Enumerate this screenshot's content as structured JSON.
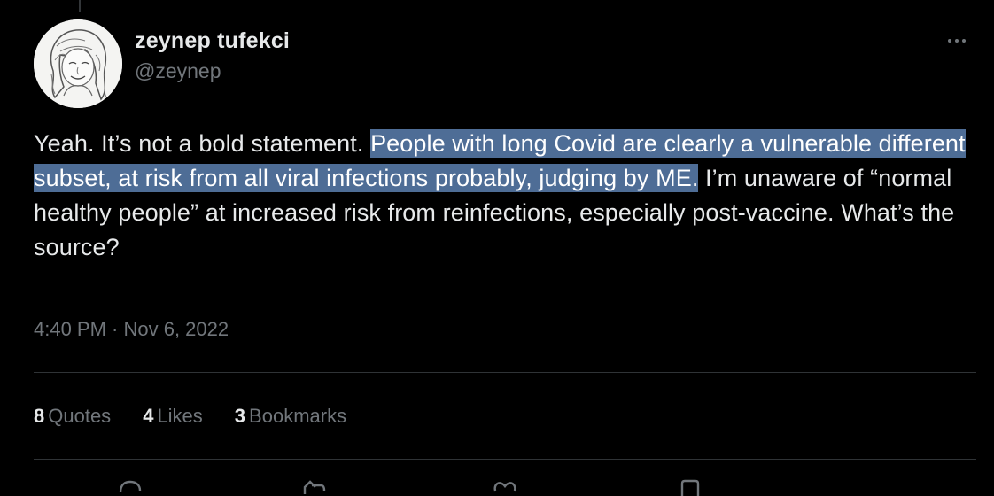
{
  "author": {
    "display_name": "zeynep tufekci",
    "handle": "@zeynep",
    "avatar_icon": "avatar-illustration"
  },
  "tweet": {
    "text_before": "Yeah. It’s not a bold statement. ",
    "text_highlighted": "People with long Covid are clearly a vulnerable different subset, at risk from all viral infections probably, judging by ME.",
    "text_after": " I’m unaware of “normal healthy people” at increased risk from reinfections, especially post-vaccine. What’s the source?",
    "highlight_color": "#4e6d96",
    "timestamp": "4:40 PM · Nov 6, 2022"
  },
  "stats": {
    "quotes_count": "8",
    "quotes_label": "Quotes",
    "likes_count": "4",
    "likes_label": "Likes",
    "bookmarks_count": "3",
    "bookmarks_label": "Bookmarks"
  },
  "actions": [
    "reply-icon",
    "retweet-icon",
    "like-icon",
    "bookmark-icon"
  ],
  "colors": {
    "background": "#000000",
    "primary_text": "#e7e9ea",
    "secondary_text": "#71767b",
    "divider": "#2f3336"
  }
}
